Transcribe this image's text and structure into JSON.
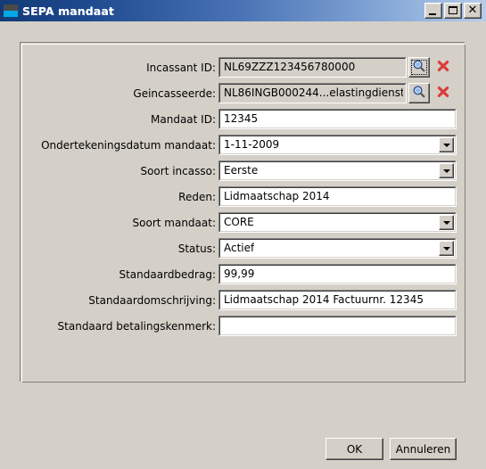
{
  "window": {
    "title": "SEPA mandaat",
    "icon": "app-icon",
    "controls": {
      "minimize": "minimize-icon",
      "maximize": "maximize-icon",
      "close": "close-icon"
    }
  },
  "colors": {
    "face": "#d4d0c8",
    "title_gradient_start": "#123a77",
    "title_gradient_end": "#b6cdea",
    "field_background": "#ffffff",
    "readonly_background": "#d4d0c8",
    "clear_icon": "#e04545",
    "search_icon": "#5a7fc0"
  },
  "form": {
    "rows": [
      {
        "label": "Incassant ID:",
        "value": "NL69ZZZ123456780000",
        "type": "lookup",
        "readonly": true,
        "focused": true,
        "search_icon": "search-icon",
        "clear_icon": "clear-icon"
      },
      {
        "label": "Geincasseerde:",
        "value": "NL86INGB000244...elastingdienst",
        "type": "lookup",
        "readonly": true,
        "focused": false,
        "search_icon": "search-icon",
        "clear_icon": "clear-icon"
      },
      {
        "label": "Mandaat ID:",
        "value": "12345",
        "type": "text",
        "readonly": false
      },
      {
        "label": "Ondertekeningsdatum mandaat:",
        "value": "1-11-2009",
        "type": "combo",
        "readonly": false
      },
      {
        "label": "Soort incasso:",
        "value": "Eerste",
        "type": "combo",
        "readonly": false
      },
      {
        "label": "Reden:",
        "value": "Lidmaatschap 2014",
        "type": "text",
        "readonly": false
      },
      {
        "label": "Soort mandaat:",
        "value": "CORE",
        "type": "combo",
        "readonly": false
      },
      {
        "label": "Status:",
        "value": "Actief",
        "type": "combo",
        "readonly": false
      },
      {
        "label": "Standaardbedrag:",
        "value": "99,99",
        "type": "text",
        "readonly": false
      },
      {
        "label": "Standaardomschrijving:",
        "value": "Lidmaatschap 2014 Factuurnr. 12345",
        "type": "text",
        "readonly": false
      },
      {
        "label": "Standaard betalingskenmerk:",
        "value": "",
        "type": "text",
        "readonly": false
      }
    ]
  },
  "buttons": {
    "ok": "OK",
    "cancel": "Annuleren"
  }
}
